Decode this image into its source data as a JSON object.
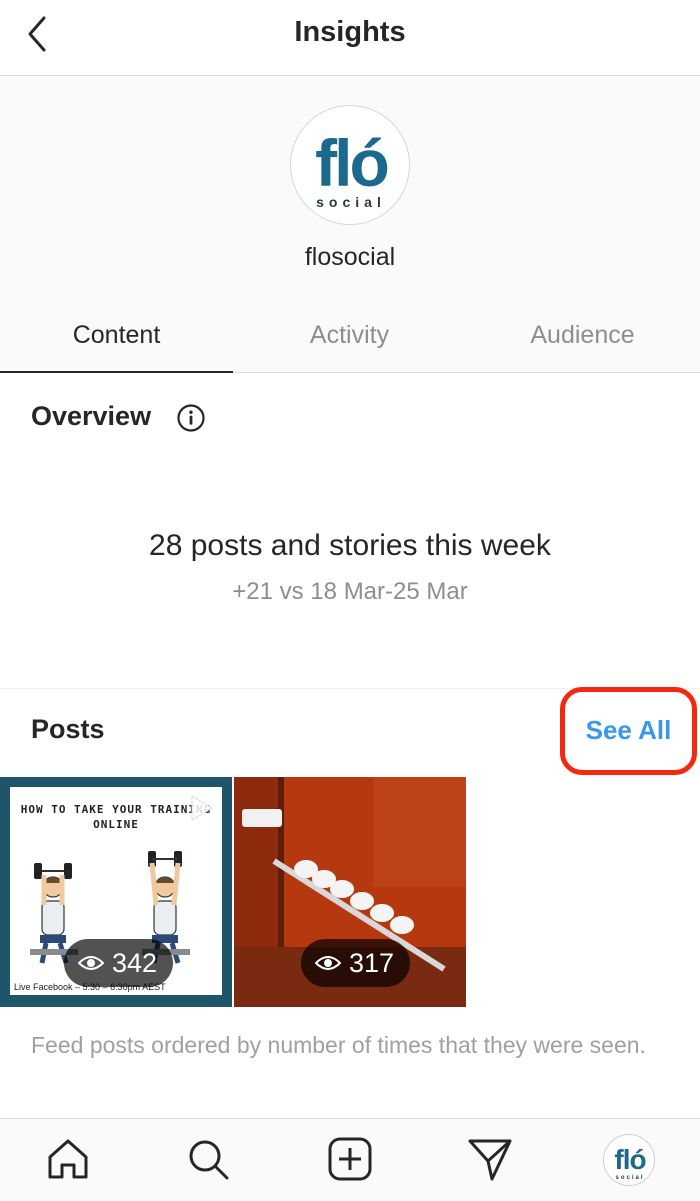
{
  "header": {
    "title": "Insights",
    "back_icon": "chevron-left-icon"
  },
  "profile": {
    "username": "flosocial",
    "logo_text": "fló",
    "logo_subtext": "social"
  },
  "tabs": [
    {
      "label": "Content",
      "active": true
    },
    {
      "label": "Activity",
      "active": false
    },
    {
      "label": "Audience",
      "active": false
    }
  ],
  "overview": {
    "title": "Overview",
    "info_icon": "info-icon",
    "headline": "28 posts and stories this week",
    "comparison": "+21 vs 18 Mar-25 Mar"
  },
  "posts": {
    "title": "Posts",
    "see_all_label": "See All",
    "highlight_color": "#f3280e",
    "link_color": "#3897f0",
    "items": [
      {
        "title_text": "HOW TO TAKE YOUR TRAINING ONLINE",
        "caption": "Live Facebook – 5:30 – 6:30pm AEST",
        "views": "342",
        "type_icon": "video-icon"
      },
      {
        "views": "317"
      }
    ],
    "note": "Feed posts ordered by number of times that they were seen."
  },
  "bottom_nav": [
    {
      "icon": "home-icon"
    },
    {
      "icon": "search-icon"
    },
    {
      "icon": "new-post-icon"
    },
    {
      "icon": "direct-message-icon"
    },
    {
      "icon": "profile-avatar-icon"
    }
  ]
}
